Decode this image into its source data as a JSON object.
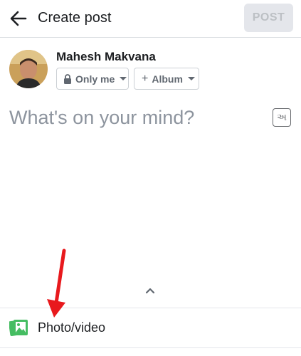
{
  "header": {
    "title": "Create post",
    "post_label": "POST"
  },
  "user": {
    "name": "Mahesh Makvana"
  },
  "privacy": {
    "selected": "Only me"
  },
  "album": {
    "label": "Album",
    "prefix": "+"
  },
  "composer": {
    "placeholder": "What's on your mind?",
    "translit_glyph": "અ"
  },
  "attachments": {
    "photo_video_label": "Photo/video"
  },
  "colors": {
    "annotation_arrow": "#e8191d",
    "photo_icon": "#45bd62",
    "post_disabled_bg": "#e4e6eb"
  },
  "icons": {
    "back": "arrow-left-icon",
    "lock": "lock-icon",
    "translit": "transliteration-icon",
    "expand": "chevron-up-icon",
    "photo": "photo-video-icon"
  }
}
